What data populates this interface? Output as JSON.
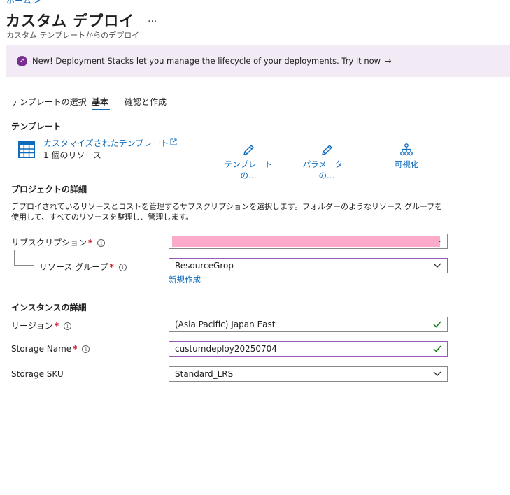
{
  "breadcrumb": "ホーム >",
  "page": {
    "title": "カスタム デプロイ",
    "more": "...",
    "subtitle": "カスタム テンプレートからのデプロイ"
  },
  "banner": {
    "text": "New! Deployment Stacks let you manage the lifecycle of your deployments. Try it now",
    "arrow": "→"
  },
  "tabs": [
    {
      "label": "テンプレートの選択",
      "active": false
    },
    {
      "label": "基本",
      "active": true
    },
    {
      "label": "確認と作成",
      "active": false
    }
  ],
  "template": {
    "heading": "テンプレート",
    "link": "カスタマイズされたテンプレート",
    "resources": "1 個のリソース",
    "actions": [
      {
        "label": "テンプレートの…",
        "icon": "pencil-icon"
      },
      {
        "label": "パラメーターの…",
        "icon": "pencil-icon"
      },
      {
        "label": "可視化",
        "icon": "hierarchy-icon"
      }
    ]
  },
  "project": {
    "heading": "プロジェクトの詳細",
    "description": "デプロイされているリソースとコストを管理するサブスクリプションを選択します。フォルダーのようなリソース グループを使用して、すべてのリソースを整理し、管理します。",
    "subscription_label": "サブスクリプション",
    "resource_group_label": "リソース グループ",
    "resource_group_value": "ResourceGrop",
    "create_new": "新規作成"
  },
  "instance": {
    "heading": "インスタンスの詳細",
    "region_label": "リージョン",
    "region_value": "(Asia Pacific) Japan East",
    "storage_name_label": "Storage Name",
    "storage_name_value": "custumdeploy20250704",
    "storage_sku_label": "Storage SKU",
    "storage_sku_value": "Standard_LRS"
  },
  "colors": {
    "accent": "#0f6cbd",
    "required": "#c50f1f",
    "valid": "#107c10",
    "banner_bg": "#f2eaf5",
    "redaction": "#fcaaca"
  }
}
